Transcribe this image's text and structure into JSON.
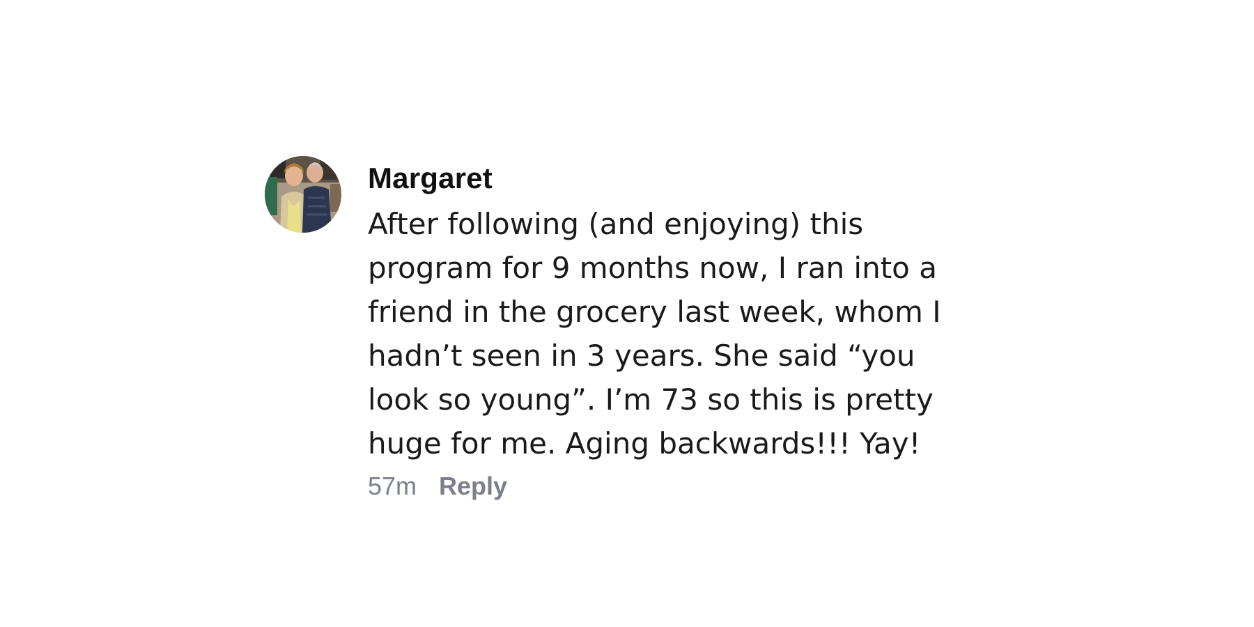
{
  "comment": {
    "author": "Margaret",
    "avatar_icon": "user-avatar-photo",
    "text": "After following (and enjoying) this\nprogram for 9 months now, I ran into a\nfriend in the grocery last week, whom I\nhadn’t seen in 3 years. She said “you\nlook so young”. I’m 73 so this is pretty\nhuge for me. Aging backwards!!! Yay!",
    "timestamp": "57m",
    "reply_label": "Reply"
  },
  "colors": {
    "meta_text": "#7b7f8c",
    "body_text": "#1a1a1a",
    "background": "#ffffff"
  }
}
